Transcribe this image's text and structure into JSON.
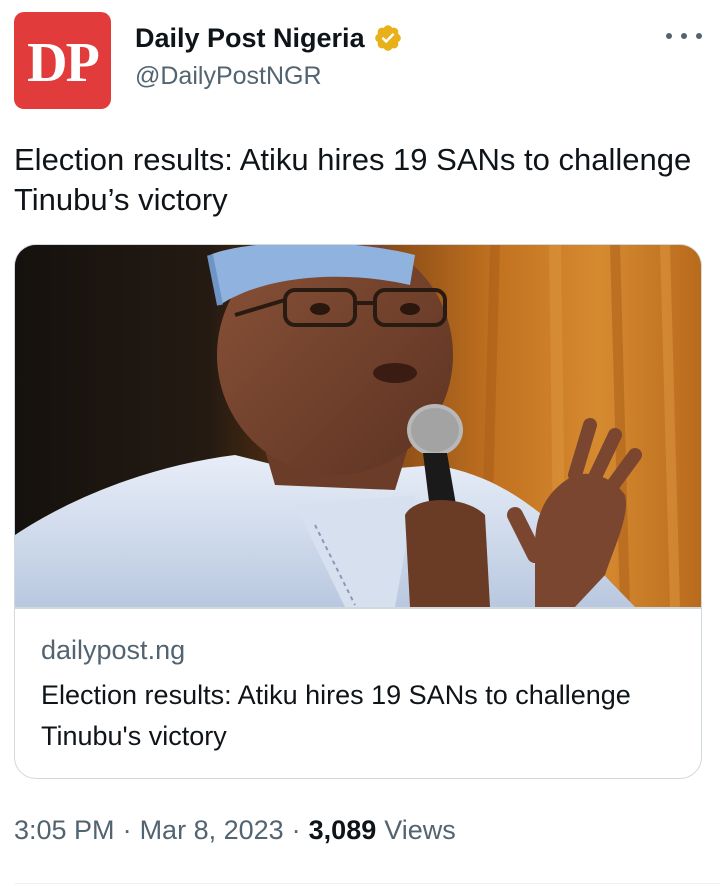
{
  "account": {
    "avatar_text": "DP",
    "avatar_color": "#e23b3b",
    "display_name": "Daily Post Nigeria",
    "handle": "@DailyPostNGR",
    "verified_badge_color": "#e8b019"
  },
  "tweet": {
    "text": "Election results: Atiku hires 19 SANs to challenge Tinubu’s victory"
  },
  "card": {
    "image_icon": "photo-of-man-speaking-into-microphone",
    "domain": "dailypost.ng",
    "title": "Election results: Atiku hires 19 SANs to challenge Tinubu's victory"
  },
  "meta": {
    "time": "3:05 PM",
    "separator": "·",
    "date": "Mar 8, 2023",
    "views_count": "3,089",
    "views_label": "Views"
  },
  "colors": {
    "text_primary": "#0f1419",
    "text_secondary": "#536471",
    "border": "#cfd9de"
  }
}
